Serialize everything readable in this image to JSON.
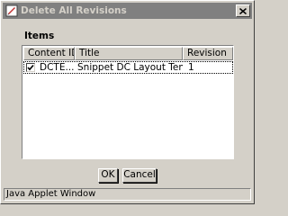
{
  "window": {
    "title": "Delete All Revisions",
    "icon": "applet-icon",
    "close_icon": "close-icon"
  },
  "items": {
    "label": "Items",
    "columns": [
      "Content ID",
      "Title",
      "Revision"
    ],
    "rows": [
      {
        "checked": true,
        "content_id": "DCTE...",
        "title": "Snippet DC Layout Templ...",
        "revision": "1"
      }
    ]
  },
  "buttons": {
    "ok": "OK",
    "cancel": "Cancel"
  },
  "status": {
    "text": "Java Applet Window"
  }
}
